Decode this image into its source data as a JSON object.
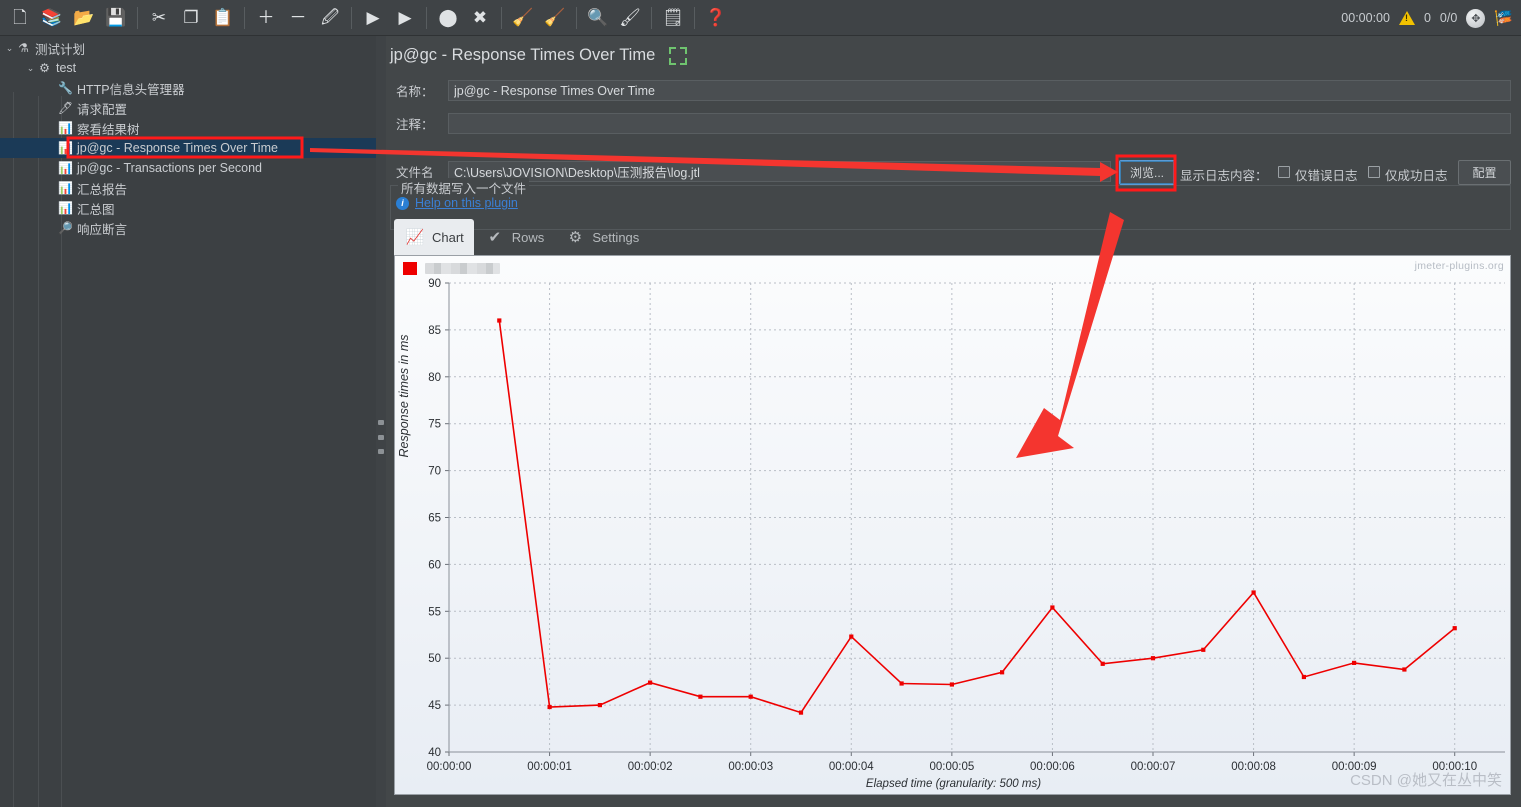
{
  "toolbar": {
    "buttons": [
      {
        "name": "new-icon",
        "glyph": "🗋",
        "title": "New"
      },
      {
        "name": "templates-icon",
        "glyph": "📚",
        "title": "Templates"
      },
      {
        "name": "open-icon",
        "glyph": "📂",
        "title": "Open"
      },
      {
        "name": "save-icon",
        "glyph": "💾",
        "title": "Save"
      },
      {
        "name": "cut-icon",
        "glyph": "✂",
        "title": "Cut"
      },
      {
        "name": "copy-icon",
        "glyph": "❐",
        "title": "Copy"
      },
      {
        "name": "paste-icon",
        "glyph": "📋",
        "title": "Paste"
      },
      {
        "name": "expand-all-icon",
        "glyph": "＋",
        "title": "Expand All"
      },
      {
        "name": "collapse-all-icon",
        "glyph": "－",
        "title": "Collapse All"
      },
      {
        "name": "toggle-icon",
        "glyph": "🖉",
        "title": "Toggle"
      },
      {
        "name": "start-icon",
        "glyph": "▶",
        "title": "Start"
      },
      {
        "name": "start-no-pause-icon",
        "glyph": "▶",
        "title": "Start no pauses"
      },
      {
        "name": "stop-icon",
        "glyph": "⬤",
        "title": "Stop"
      },
      {
        "name": "shutdown-icon",
        "glyph": "✖",
        "title": "Shutdown"
      },
      {
        "name": "clear-icon",
        "glyph": "🧹",
        "title": "Clear"
      },
      {
        "name": "clear-all-icon",
        "glyph": "🧹",
        "title": "Clear All"
      },
      {
        "name": "search-icon",
        "glyph": "🔍",
        "title": "Search"
      },
      {
        "name": "reset-search-icon",
        "glyph": "🖌",
        "title": "Reset Search"
      },
      {
        "name": "function-helper-icon",
        "glyph": "🗒",
        "title": "Function Helper Dialog"
      },
      {
        "name": "help-icon",
        "glyph": "❓",
        "title": "Help"
      }
    ],
    "status": {
      "elapsed": "00:00:00",
      "warning_count": "0",
      "threads": "0/0"
    }
  },
  "sidebar": {
    "items": [
      {
        "label": "测试计划",
        "icon": "test-plan-icon",
        "glyph": "⚗",
        "depth": 0,
        "twisty": "⌄",
        "selected": false
      },
      {
        "label": "test",
        "icon": "thread-group-icon",
        "glyph": "⚙",
        "depth": 1,
        "twisty": "⌄",
        "selected": false
      },
      {
        "label": "HTTP信息头管理器",
        "icon": "header-manager-icon",
        "glyph": "🔧",
        "depth": 2,
        "twisty": "",
        "selected": false
      },
      {
        "label": "请求配置",
        "icon": "http-request-icon",
        "glyph": "🖊",
        "depth": 2,
        "twisty": "",
        "selected": false
      },
      {
        "label": "察看结果树",
        "icon": "view-results-tree-icon",
        "glyph": "📊",
        "depth": 2,
        "twisty": "",
        "selected": false
      },
      {
        "label": "jp@gc - Response Times Over Time",
        "icon": "listener-chart-icon",
        "glyph": "📊",
        "depth": 2,
        "twisty": "",
        "selected": true
      },
      {
        "label": "jp@gc - Transactions per Second",
        "icon": "listener-chart-icon",
        "glyph": "📊",
        "depth": 2,
        "twisty": "",
        "selected": false
      },
      {
        "label": "汇总报告",
        "icon": "summary-report-icon",
        "glyph": "📊",
        "depth": 2,
        "twisty": "",
        "selected": false
      },
      {
        "label": "汇总图",
        "icon": "aggregate-graph-icon",
        "glyph": "📊",
        "depth": 2,
        "twisty": "",
        "selected": false
      },
      {
        "label": "响应断言",
        "icon": "response-assertion-icon",
        "glyph": "🔎",
        "depth": 2,
        "twisty": "",
        "selected": false
      }
    ]
  },
  "main": {
    "title": "jp@gc - Response Times Over Time",
    "name_label": "名称：",
    "name_value": "jp@gc - Response Times Over Time",
    "comment_label": "注释：",
    "comment_value": "",
    "fieldset_label": "所有数据写入一个文件",
    "filename_label": "文件名",
    "filename_value": "C:\\Users\\JOVISION\\Desktop\\压测报告\\log.jtl",
    "browse_button": "浏览...",
    "log_content_label": "显示日志内容：",
    "errors_only_label": "仅错误日志",
    "success_only_label": "仅成功日志",
    "configure_button": "配置",
    "help_link": "Help on this plugin",
    "tabs": [
      {
        "label": "Chart",
        "icon": "chart-tab-icon",
        "glyph": "📈",
        "active": true
      },
      {
        "label": "Rows",
        "icon": "rows-tab-icon",
        "glyph": "✔",
        "active": false
      },
      {
        "label": "Settings",
        "icon": "settings-tab-icon",
        "glyph": "⚙",
        "active": false
      }
    ]
  },
  "chart_data": {
    "type": "line",
    "title": "",
    "xlabel": "Elapsed time (granularity: 500 ms)",
    "ylabel": "Response times in ms",
    "ylim": [
      40,
      90
    ],
    "yticks": [
      40,
      45,
      50,
      55,
      60,
      65,
      70,
      75,
      80,
      85,
      90
    ],
    "xlim": [
      0,
      10.5
    ],
    "xticks": [
      0,
      1,
      2,
      3,
      4,
      5,
      6,
      7,
      8,
      9,
      10
    ],
    "xticklabels": [
      "00:00:00",
      "00:00:01",
      "00:00:02",
      "00:00:03",
      "00:00:04",
      "00:00:05",
      "00:00:06",
      "00:00:07",
      "00:00:08",
      "00:00:09",
      "00:00:10"
    ],
    "grid": true,
    "legend_position": "top-left",
    "watermark": "jmeter-plugins.org",
    "csdn_watermark": "CSDN @她又在丛中笑",
    "series": [
      {
        "name": "(redacted)",
        "color": "#ee0000",
        "x": [
          0.5,
          1.0,
          1.5,
          2.0,
          2.5,
          3.0,
          3.5,
          4.0,
          4.5,
          5.0,
          5.5,
          6.0,
          6.5,
          7.0,
          7.5,
          8.0,
          8.5,
          9.0,
          9.5,
          10.0
        ],
        "values": [
          86,
          44.8,
          45.0,
          47.4,
          45.9,
          45.9,
          44.2,
          52.3,
          47.3,
          47.2,
          48.5,
          55.4,
          49.4,
          50.0,
          50.9,
          57.0,
          48.0,
          49.5,
          48.8,
          53.2
        ]
      }
    ]
  },
  "annotations": {
    "tree_highlight": "jp@gc - Response Times Over Time",
    "browse_highlight": "浏览..."
  }
}
